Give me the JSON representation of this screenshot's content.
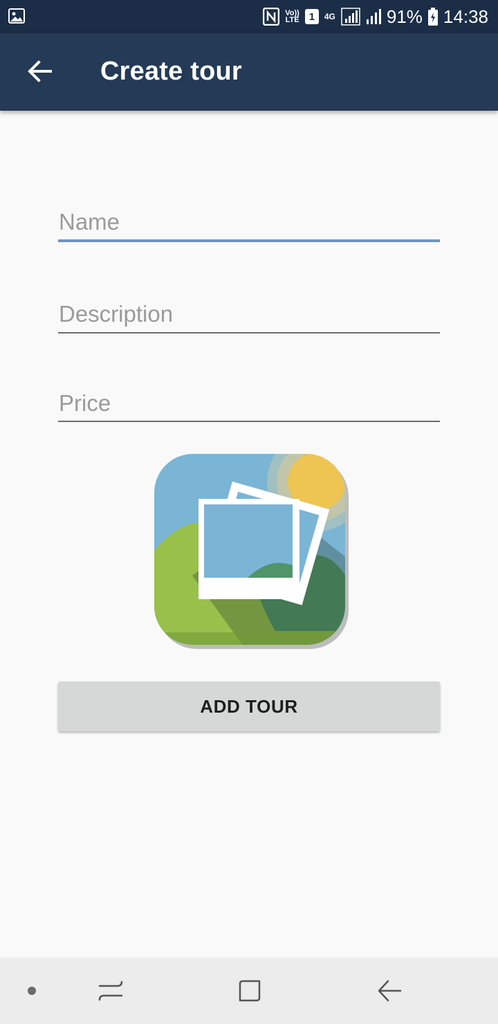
{
  "status_bar": {
    "battery": "91%",
    "time": "14:38",
    "sim_badge": "1",
    "network": "4G",
    "volte_top": "Vo))",
    "volte_bottom": "LTE",
    "icons": [
      "gallery-notification-icon",
      "nfc-icon",
      "volte-icon",
      "sim-icon",
      "4g-icon",
      "signal-icon",
      "signal-icon",
      "battery-icon"
    ]
  },
  "app_bar": {
    "title": "Create tour",
    "back_icon": "arrow-back-icon",
    "color": "#243a56"
  },
  "form": {
    "name_hint": "Name",
    "description_hint": "Description",
    "price_hint": "Price",
    "focused_field": "name",
    "accent_color": "#6e92c4"
  },
  "image_picker": {
    "icon": "gallery-placeholder-icon"
  },
  "actions": {
    "add_tour_label": "ADD TOUR"
  },
  "nav_bar": {
    "icons": [
      "dot-icon",
      "recents-icon",
      "home-icon",
      "back-icon"
    ]
  }
}
